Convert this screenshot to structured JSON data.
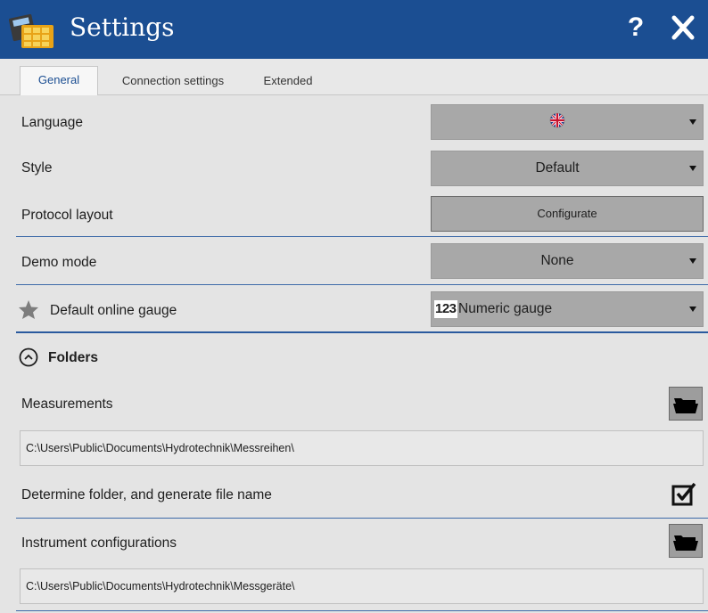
{
  "window": {
    "title": "Settings",
    "icon": "calculator-grid-icon",
    "help_label": "?",
    "colors": {
      "titlebar": "#1b4e92",
      "accent": "#1b4e92",
      "field": "#a8a8a8"
    }
  },
  "tabs": [
    {
      "label": "General",
      "active": true
    },
    {
      "label": "Connection settings",
      "active": false
    },
    {
      "label": "Extended",
      "active": false
    }
  ],
  "general": {
    "language": {
      "label": "Language",
      "value_icon": "uk-flag-icon"
    },
    "style": {
      "label": "Style",
      "value": "Default"
    },
    "protocol_layout": {
      "label": "Protocol layout",
      "button": "Configurate"
    },
    "demo_mode": {
      "label": "Demo mode",
      "value": "None"
    },
    "default_gauge": {
      "label": "Default online gauge",
      "badge": "123",
      "value": "Numeric gauge"
    }
  },
  "folders": {
    "title": "Folders",
    "measurements": {
      "label": "Measurements",
      "path": "C:\\Users\\Public\\Documents\\Hydrotechnik\\Messreihen\\"
    },
    "determine_folder": {
      "label": "Determine folder, and generate file name",
      "checked": true
    },
    "instrument_configurations": {
      "label": "Instrument configurations",
      "path": "C:\\Users\\Public\\Documents\\Hydrotechnik\\Messgeräte\\"
    }
  }
}
